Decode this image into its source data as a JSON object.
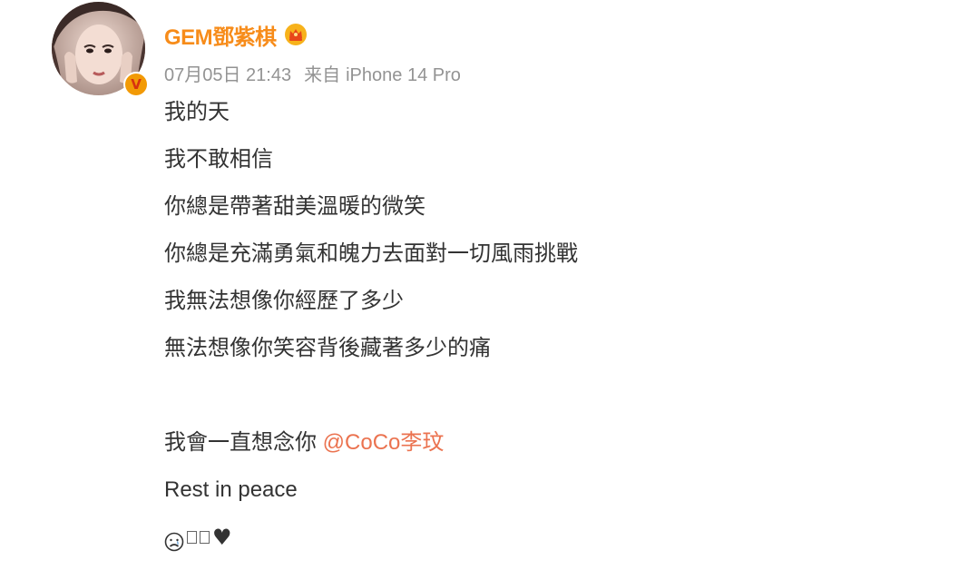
{
  "post": {
    "author": {
      "name": "GEM鄧紫棋",
      "avatar": "avatar-image",
      "verified_badge_glyph": "V",
      "vip_icon": "crown-icon",
      "colors": {
        "name": "#f78c1a",
        "badge": "#f29a06"
      }
    },
    "meta": {
      "timestamp": "07月05日 21:43",
      "source_prefix": "来自",
      "device": "iPhone 14 Pro"
    },
    "body": {
      "lines": [
        "我的天",
        "我不敢相信",
        "你總是帶著甜美溫暖的微笑",
        "你總是充滿勇氣和魄力去面對一切風雨挑戰",
        "我無法想像你經歷了多少",
        "無法想像你笑容背後藏著多少的痛"
      ],
      "closing_text": "我會一直想念你 ",
      "mention": "@CoCo李玟",
      "mention_color": "#eb7350",
      "english_line": "Rest in peace",
      "emoji_row": [
        "sad-face-icon",
        "missing-glyph",
        "missing-glyph",
        "heart-icon"
      ],
      "heart_glyph": "♥"
    }
  }
}
